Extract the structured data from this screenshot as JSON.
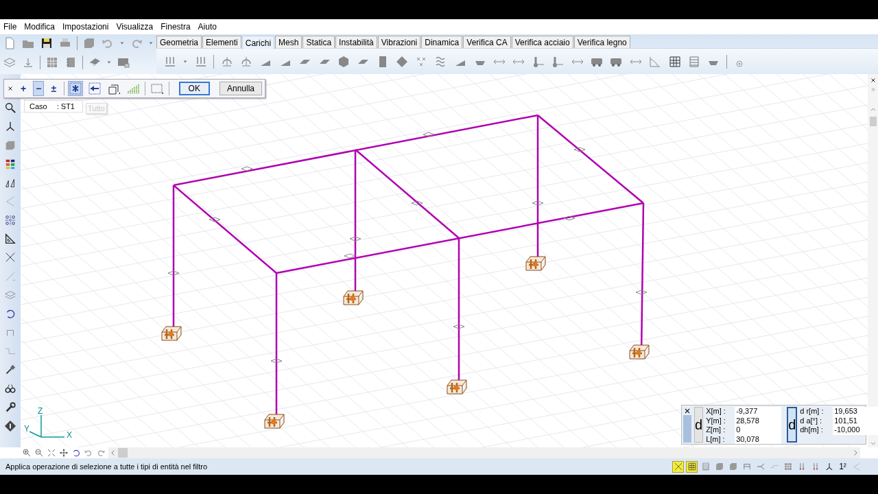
{
  "menu": [
    "File",
    "Modifica",
    "Impostazioni",
    "Visualizza",
    "Finestra",
    "Aiuto"
  ],
  "tabs": [
    {
      "label": "Geometria",
      "selected": false
    },
    {
      "label": "Elementi",
      "selected": false
    },
    {
      "label": "Carichi",
      "selected": true
    },
    {
      "label": "Mesh",
      "selected": false
    },
    {
      "label": "Statica",
      "selected": false
    },
    {
      "label": "Instabilità",
      "selected": false
    },
    {
      "label": "Vibrazioni",
      "selected": false
    },
    {
      "label": "Dinamica",
      "selected": false
    },
    {
      "label": "Verifica CA",
      "selected": false
    },
    {
      "label": "Verifica acciaio",
      "selected": false
    },
    {
      "label": "Verifica legno",
      "selected": false
    }
  ],
  "filter_bar": {
    "tools": [
      {
        "kind": "symbol",
        "symbol": "+",
        "pressed": false
      },
      {
        "kind": "symbol",
        "symbol": "−",
        "pressed": true
      },
      {
        "kind": "symbol",
        "symbol": "±",
        "pressed": false
      },
      {
        "kind": "all",
        "pressed": true
      },
      {
        "kind": "back",
        "pressed": false
      },
      {
        "kind": "filter",
        "pressed": false
      },
      {
        "kind": "levels",
        "pressed": false
      },
      {
        "kind": "window",
        "pressed": false
      }
    ],
    "buttons": [
      {
        "label": "OK",
        "default": true
      },
      {
        "label": "Annulla",
        "default": false
      }
    ]
  },
  "case_label": {
    "label": "Caso",
    "value": ": ST1"
  },
  "tooltip": "Tutto",
  "axes": {
    "x": "X",
    "y": "Y",
    "z": "Z"
  },
  "coordinates": {
    "buttons": [
      {
        "label": "d",
        "pressed": false
      },
      {
        "label": "d",
        "pressed": true
      }
    ],
    "absolute": [
      {
        "label": "X[m] :",
        "value": "-9,377"
      },
      {
        "label": "Y[m] :",
        "value": "28,578"
      },
      {
        "label": "Z[m] :",
        "value": "0"
      },
      {
        "label": "L[m] :",
        "value": "30,078"
      }
    ],
    "relative": [
      {
        "label": "d r[m] :",
        "value": "19,653"
      },
      {
        "label": "d a[°] :",
        "value": "101,51"
      },
      {
        "label": "dh[m] :",
        "value": "-10,000"
      }
    ]
  },
  "status_bar": {
    "message": "Applica operazione di selezione a tutte i tipi di entità nel filtro",
    "tools": [
      {
        "kind": "cross",
        "on": true
      },
      {
        "kind": "grid",
        "on": true
      },
      {
        "kind": "list",
        "on": false
      },
      {
        "kind": "cube",
        "on": false
      },
      {
        "kind": "cube",
        "on": false
      },
      {
        "kind": "frame",
        "on": false
      },
      {
        "kind": "node",
        "on": false
      },
      {
        "kind": "step",
        "on": false
      },
      {
        "kind": "table",
        "on": false
      },
      {
        "kind": "arrows",
        "on": false
      },
      {
        "kind": "arrows",
        "on": false
      },
      {
        "kind": "axes",
        "on": false
      },
      {
        "kind": "symbol",
        "symbol": "1²",
        "on": false
      },
      {
        "kind": "angle",
        "on": false
      }
    ]
  }
}
